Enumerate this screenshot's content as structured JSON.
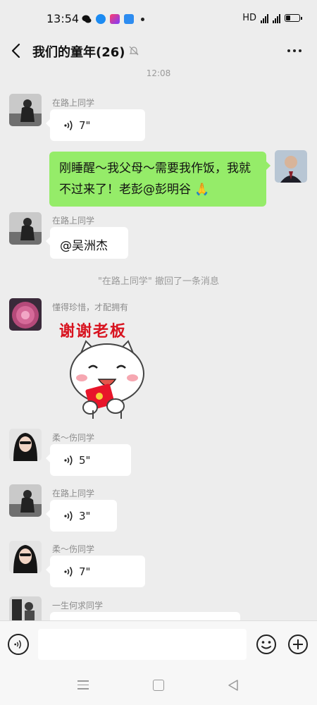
{
  "status_bar": {
    "time": "13:54",
    "hd": "HD",
    "net1": "4G",
    "net2": "4G",
    "battery_level": 0.35
  },
  "header": {
    "title": "我们的童年(26)"
  },
  "timestamp": "12:08",
  "messages": [
    {
      "sender": "在路上同学",
      "type": "voice",
      "duration": "7\""
    },
    {
      "type": "outgoing_text",
      "text": "刚睡醒～我父母～需要我作饭，我就不过来了！老彭@彭明谷 🙏"
    },
    {
      "sender": "在路上同学",
      "type": "text",
      "text": "@吴洲杰"
    },
    {
      "type": "system",
      "text": "\"在路上同学\" 撤回了一条消息"
    },
    {
      "sender": "懂得珍惜，才配拥有",
      "type": "sticker",
      "sticker_text": "谢谢老板"
    },
    {
      "sender": "柔～伤同学",
      "type": "voice",
      "duration": "5\""
    },
    {
      "sender": "在路上同学",
      "type": "voice",
      "duration": "3\""
    },
    {
      "sender": "柔～伤同学",
      "type": "voice",
      "duration": "7\""
    },
    {
      "sender": "一生何求同学",
      "type": "voice",
      "duration": ""
    }
  ],
  "colors": {
    "background": "#ededed",
    "outgoing_bubble": "#95ec69",
    "incoming_bubble": "#ffffff"
  }
}
